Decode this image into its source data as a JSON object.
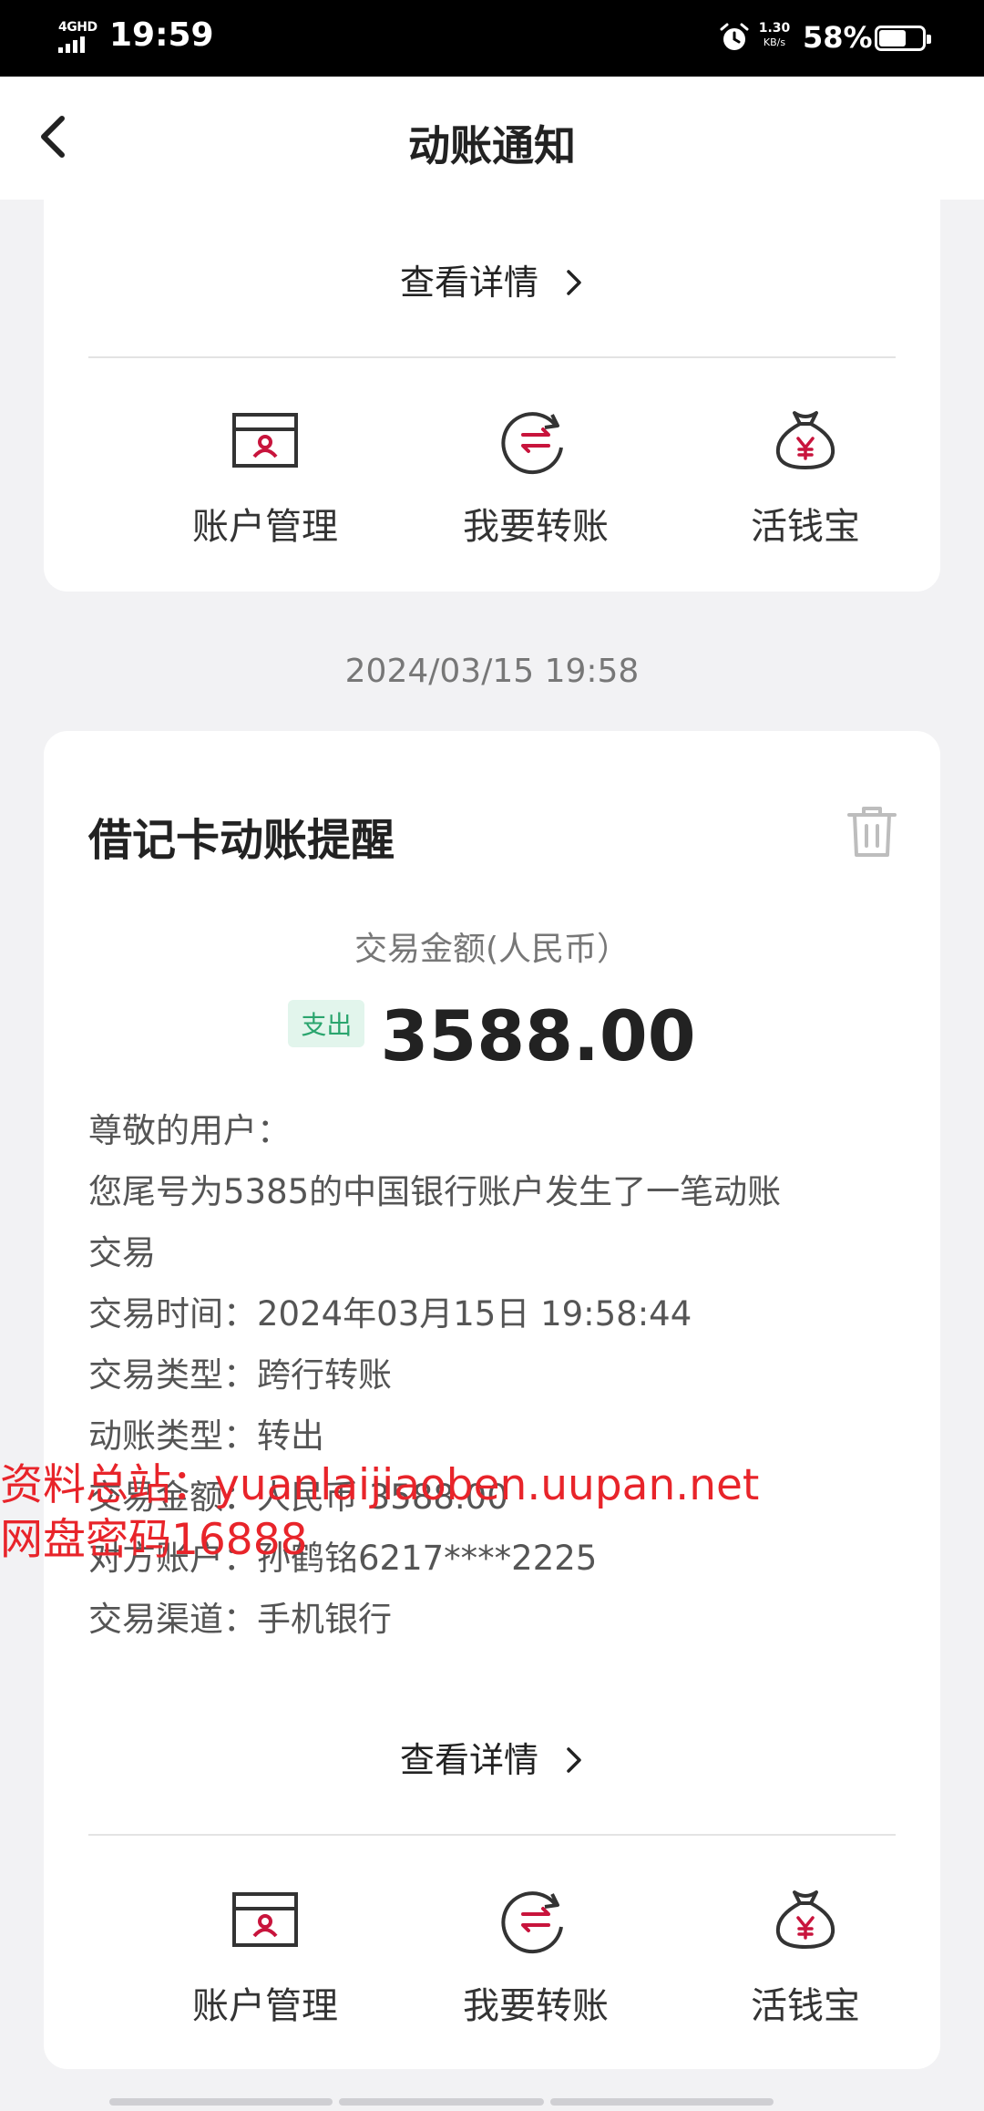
{
  "status_bar": {
    "network": "4GHD",
    "time": "19:59",
    "speed_value": "1.30",
    "speed_unit": "KB/s",
    "battery_percent": "58%"
  },
  "nav": {
    "title": "动账通知"
  },
  "top_card": {
    "detail_label": "查看详情",
    "actions": [
      {
        "label": "账户管理",
        "icon": "account-card-icon"
      },
      {
        "label": "我要转账",
        "icon": "transfer-icon"
      },
      {
        "label": "活钱宝",
        "icon": "money-bag-icon"
      }
    ]
  },
  "timestamp": "2024/03/15 19:58",
  "notice": {
    "title": "借记卡动账提醒",
    "amount_label": "交易金额(人民币）",
    "tag": "支出",
    "amount": "3588.00",
    "lines": [
      "尊敬的用户：",
      "您尾号为5385的中国银行账户发生了一笔动账",
      "交易",
      "交易时间：2024年03月15日 19:58:44",
      "交易类型：跨行转账",
      "动账类型：转出",
      "交易金额：人民币 3588.00",
      "对方账户：孙鹤铭6217****2225",
      "交易渠道：手机银行"
    ],
    "detail_label": "查看详情",
    "actions": [
      {
        "label": "账户管理",
        "icon": "account-card-icon"
      },
      {
        "label": "我要转账",
        "icon": "transfer-icon"
      },
      {
        "label": "活钱宝",
        "icon": "money-bag-icon"
      }
    ]
  },
  "watermark": {
    "line1": "资料总站：yuanlaijiaoben.uupan.net",
    "line2": "网盘密码16888"
  },
  "colors": {
    "accent_red": "#c8143c",
    "tag_green": "#2aa56e",
    "tag_bg": "#e2f5ec",
    "watermark_red": "#e8242a"
  }
}
